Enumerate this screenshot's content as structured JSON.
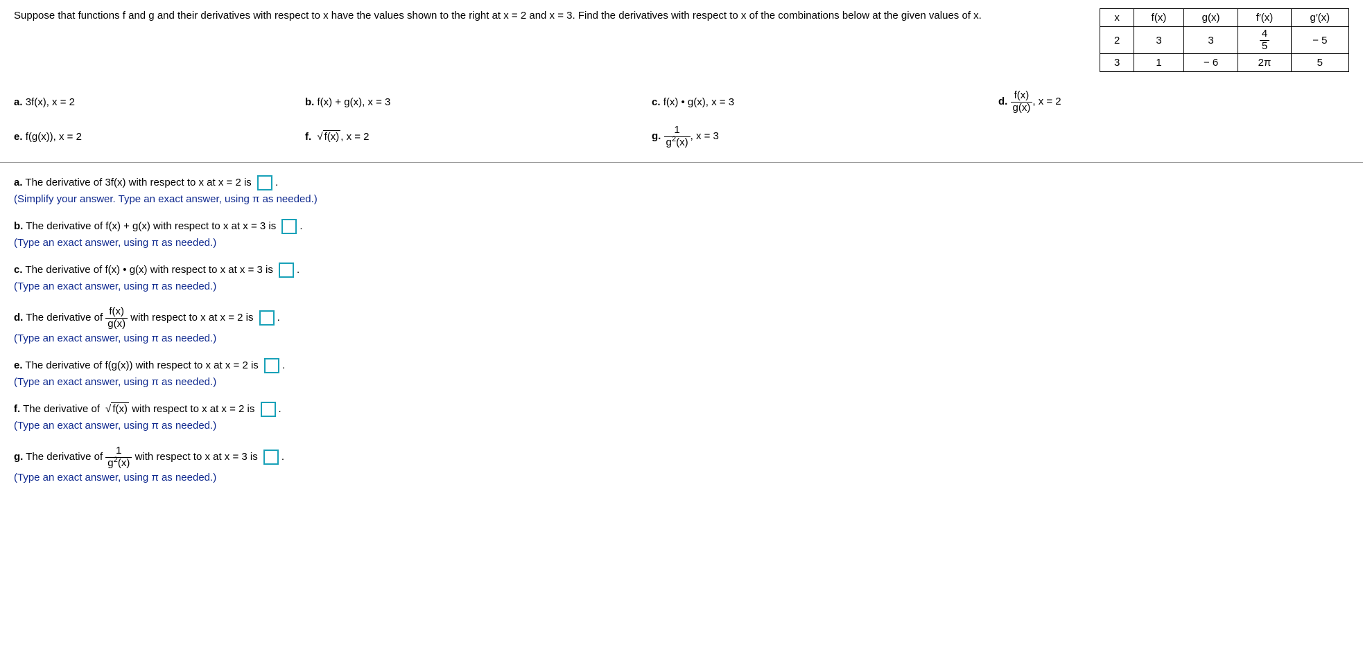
{
  "intro": "Suppose that functions f and g and their derivatives with respect to x have the values shown to the right at x = 2 and x = 3. Find the derivatives with respect to x of the combinations below at the given values of x.",
  "table": {
    "headers": {
      "x": "x",
      "fx": "f(x)",
      "gx": "g(x)",
      "fpx": "f′(x)",
      "gpx": "g′(x)"
    },
    "row1": {
      "x": "2",
      "fx": "3",
      "gx": "3",
      "fpx_num": "4",
      "fpx_den": "5",
      "gpx": "− 5"
    },
    "row2": {
      "x": "3",
      "fx": "1",
      "gx": "− 6",
      "fpx": "2π",
      "gpx": "5"
    }
  },
  "parts": {
    "a": {
      "label": "a.",
      "expr": "3f(x),  x = 2"
    },
    "b": {
      "label": "b.",
      "expr": "f(x) + g(x),  x = 3"
    },
    "c": {
      "label": "c.",
      "expr": "f(x) • g(x),  x = 3"
    },
    "d": {
      "label": "d.",
      "num": "f(x)",
      "den": "g(x)",
      "tail": ",  x = 2"
    },
    "e": {
      "label": "e.",
      "expr": "f(g(x)),  x = 2"
    },
    "f": {
      "label": "f.",
      "rad": "f(x)",
      "tail": ",  x = 2"
    },
    "g": {
      "label": "g.",
      "num": "1",
      "den": "g",
      "den_sup": "2",
      "den_tail": "(x)",
      "tail": ",  x = 3"
    }
  },
  "answers": {
    "a": {
      "pre": "a.",
      "text_before": " The derivative of 3f(x) with respect to x at x = 2 is ",
      "after": ".",
      "hint": "(Simplify your answer. Type an exact answer, using π as needed.)"
    },
    "b": {
      "pre": "b.",
      "text_before": " The derivative of f(x) + g(x) with respect to x at x = 3 is ",
      "after": ".",
      "hint": "(Type an exact answer, using π as needed.)"
    },
    "c": {
      "pre": "c.",
      "text_before": " The derivative of f(x) • g(x) with respect to x at x = 3 is ",
      "after": ".",
      "hint": "(Type an exact answer, using π as needed.)"
    },
    "d": {
      "pre": "d.",
      "t1": " The derivative of ",
      "num": "f(x)",
      "den": "g(x)",
      "t2": " with respect to x at x = 2 is ",
      "after": ".",
      "hint": "(Type an exact answer, using π as needed.)"
    },
    "e": {
      "pre": "e.",
      "text_before": " The derivative of f(g(x)) with respect to x at x = 2 is ",
      "after": ".",
      "hint": "(Type an exact answer, using π as needed.)"
    },
    "f": {
      "pre": "f.",
      "t1": " The derivative of ",
      "rad": "f(x)",
      "t2": " with respect to x at x = 2 is ",
      "after": ".",
      "hint": "(Type an exact answer, using π as needed.)"
    },
    "g": {
      "pre": "g.",
      "t1": " The derivative of ",
      "num": "1",
      "den": "g",
      "den_sup": "2",
      "den_tail": "(x)",
      "t2": " with respect to x at x = 3 is ",
      "after": ".",
      "hint": "(Type an exact answer, using π as needed.)"
    }
  }
}
